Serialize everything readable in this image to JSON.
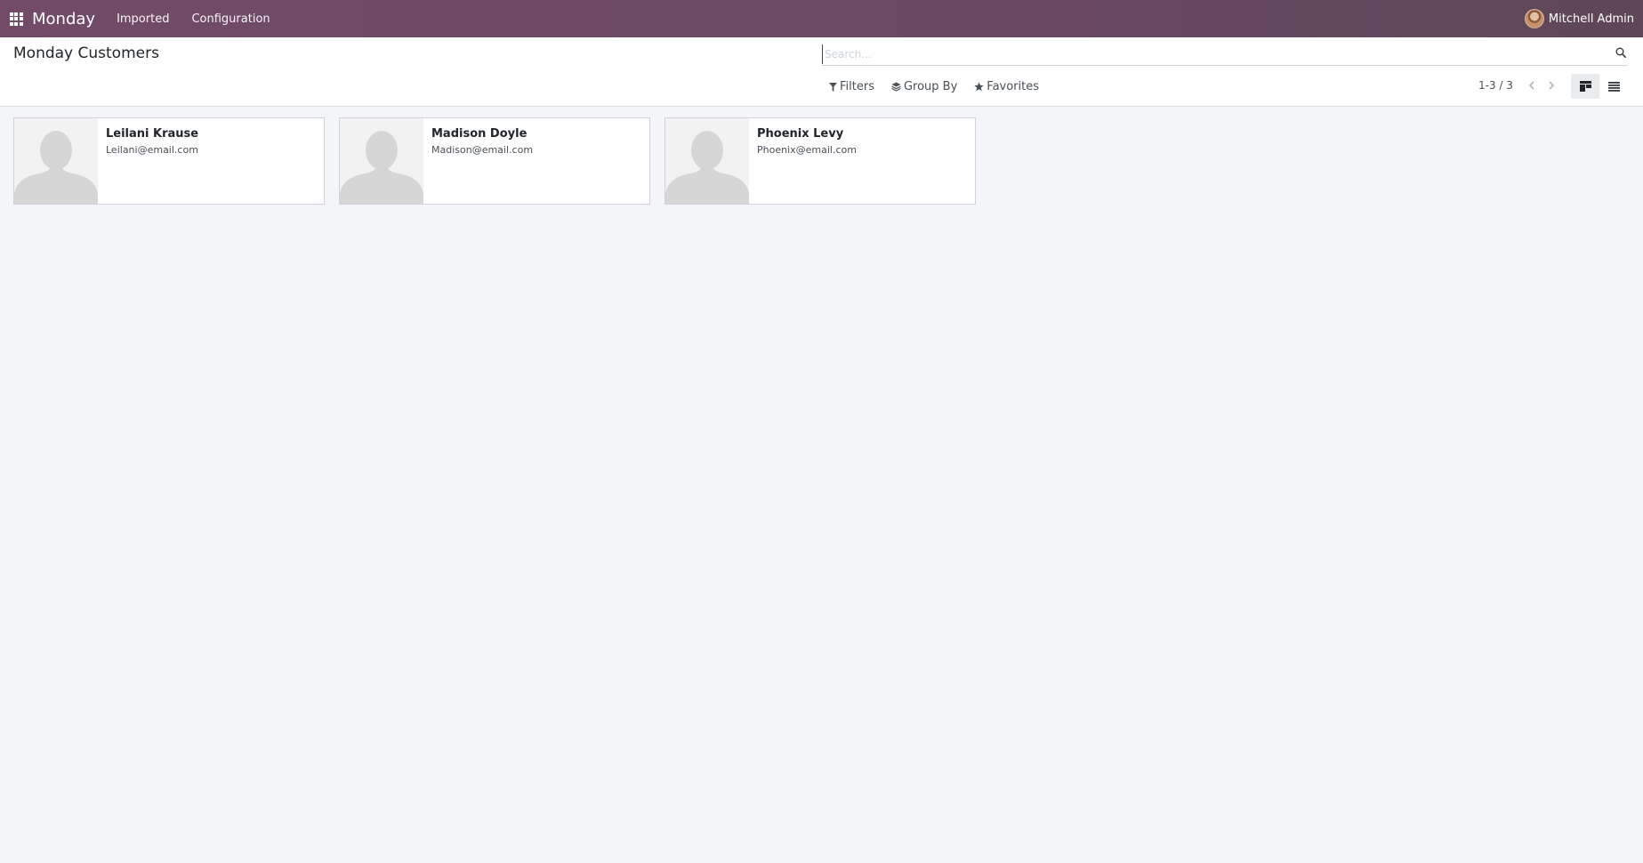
{
  "navbar": {
    "brand": "Monday",
    "menu": [
      {
        "label": "Imported"
      },
      {
        "label": "Configuration"
      }
    ],
    "user": "Mitchell Admin",
    "color": "#714b67"
  },
  "control_panel": {
    "title": "Monday Customers",
    "search": {
      "placeholder": "Search...",
      "value": ""
    },
    "filters_label": "Filters",
    "groupby_label": "Group By",
    "favorites_label": "Favorites",
    "pager": "1-3 / 3",
    "views": [
      "kanban",
      "list"
    ],
    "active_view": "kanban"
  },
  "customers": [
    {
      "name": "Leilani Krause",
      "email": "Leilani@email.com"
    },
    {
      "name": "Madison Doyle",
      "email": "Madison@email.com"
    },
    {
      "name": "Phoenix Levy",
      "email": "Phoenix@email.com"
    }
  ],
  "icons": {
    "apps": "apps-grid-icon",
    "search": "search-icon",
    "filter": "filter-icon",
    "groupby": "layers-icon",
    "favorites": "star-icon",
    "prev": "chevron-left-icon",
    "next": "chevron-right-icon",
    "kanban": "kanban-view-icon",
    "list": "list-view-icon",
    "placeholder": "person-placeholder-icon"
  }
}
